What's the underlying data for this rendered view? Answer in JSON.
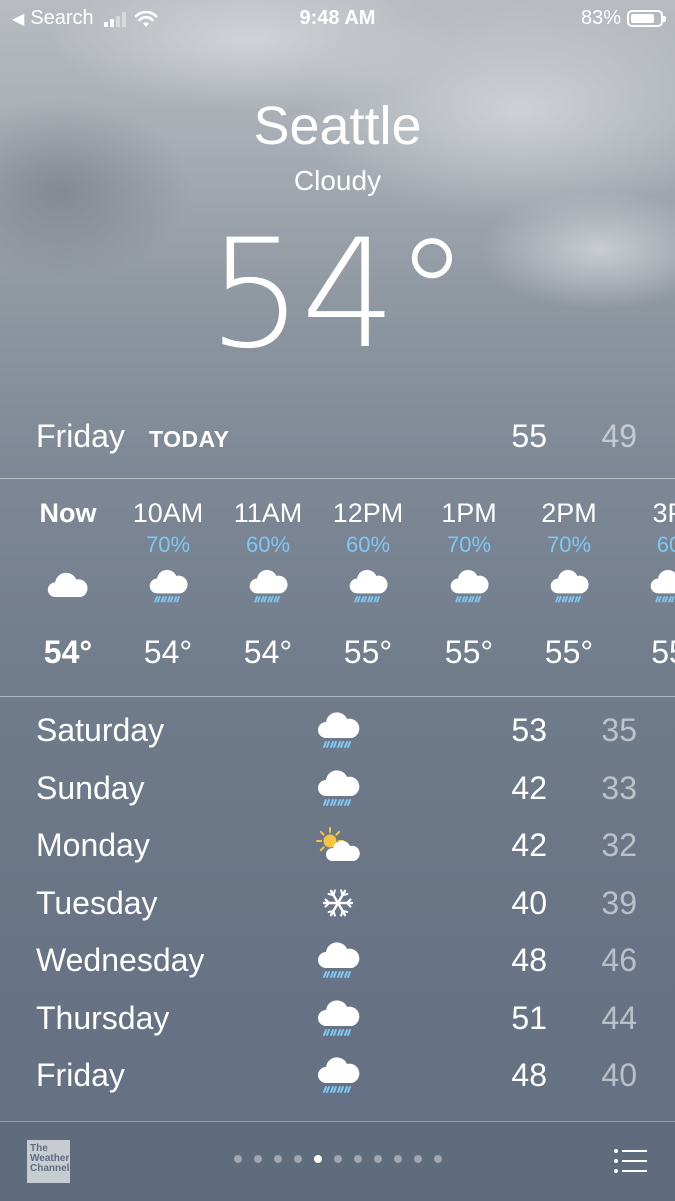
{
  "status_bar": {
    "back_label": "Search",
    "time": "9:48 AM",
    "battery": "83%",
    "battery_level": 0.83
  },
  "location": {
    "city": "Seattle",
    "condition": "Cloudy",
    "temperature": "54°"
  },
  "today": {
    "day": "Friday",
    "tag": "TODAY",
    "high": "55",
    "low": "49"
  },
  "hourly": [
    {
      "time": "Now",
      "precip": "",
      "icon": "cloud-icon",
      "temp": "54°"
    },
    {
      "time": "10AM",
      "precip": "70%",
      "icon": "rain-icon",
      "temp": "54°"
    },
    {
      "time": "11AM",
      "precip": "60%",
      "icon": "rain-icon",
      "temp": "54°"
    },
    {
      "time": "12PM",
      "precip": "60%",
      "icon": "rain-icon",
      "temp": "55°"
    },
    {
      "time": "1PM",
      "precip": "70%",
      "icon": "rain-icon",
      "temp": "55°"
    },
    {
      "time": "2PM",
      "precip": "70%",
      "icon": "rain-icon",
      "temp": "55°"
    },
    {
      "time": "3P",
      "precip": "60",
      "icon": "rain-icon",
      "temp": "55"
    }
  ],
  "daily": [
    {
      "day": "Saturday",
      "icon": "rain-icon",
      "high": "53",
      "low": "35"
    },
    {
      "day": "Sunday",
      "icon": "rain-icon",
      "high": "42",
      "low": "33"
    },
    {
      "day": "Monday",
      "icon": "partly-sunny-icon",
      "high": "42",
      "low": "32"
    },
    {
      "day": "Tuesday",
      "icon": "snowflake-icon",
      "high": "40",
      "low": "39"
    },
    {
      "day": "Wednesday",
      "icon": "rain-icon",
      "high": "48",
      "low": "46"
    },
    {
      "day": "Thursday",
      "icon": "rain-icon",
      "high": "51",
      "low": "44"
    },
    {
      "day": "Friday",
      "icon": "rain-icon",
      "high": "48",
      "low": "40"
    }
  ],
  "bottom_bar": {
    "provider_logo_text": "The Weather Channel",
    "page_count": 11,
    "active_page": 5,
    "list_icon": "list-icon"
  },
  "colors": {
    "precip_text": "#7ec8f5",
    "bottom_bar": "#5f6c7e",
    "sun": "#f5c542"
  }
}
